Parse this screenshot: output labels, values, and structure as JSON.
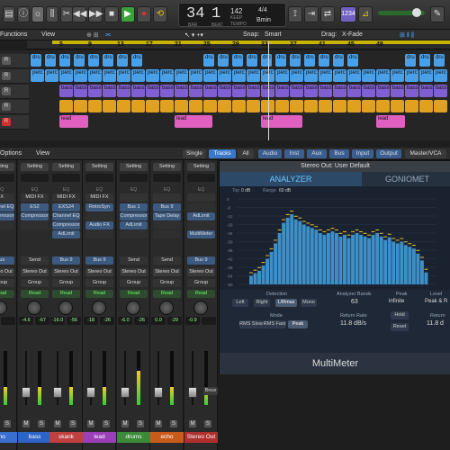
{
  "toolbar": {
    "bar": "34",
    "beat": "1",
    "bar_label": "BAR",
    "beat_label": "BEAT",
    "tempo": "142",
    "tempo_label": "KEEP",
    "tempo_sub": "TEMPO",
    "sig": "4/4",
    "key": "Bmin",
    "count_in": "1234"
  },
  "menubar": {
    "functions": "Functions",
    "view": "View",
    "snap_label": "Snap:",
    "snap_value": "Smart",
    "drag_label": "Drag:",
    "drag_value": "X-Fade"
  },
  "ruler": [
    "5",
    "9",
    "13",
    "17",
    "21",
    "25",
    "29",
    "33",
    "37",
    "41",
    "45",
    "49"
  ],
  "tracks": [
    {
      "rec": "R",
      "regions": [
        {
          "label": "dru",
          "x": 34,
          "w": 12
        },
        {
          "label": "dru",
          "x": 50,
          "w": 12
        },
        {
          "label": "dru",
          "x": 66,
          "w": 12
        },
        {
          "label": "dru",
          "x": 82,
          "w": 12
        },
        {
          "label": "dru",
          "x": 98,
          "w": 12
        },
        {
          "label": "dru",
          "x": 114,
          "w": 12
        },
        {
          "label": "dru",
          "x": 130,
          "w": 12
        },
        {
          "label": "dru",
          "x": 146,
          "w": 12
        },
        {
          "label": "dru",
          "x": 226,
          "w": 12
        },
        {
          "label": "dru",
          "x": 242,
          "w": 12
        },
        {
          "label": "dru",
          "x": 258,
          "w": 12
        },
        {
          "label": "dru",
          "x": 274,
          "w": 12
        },
        {
          "label": "dru",
          "x": 290,
          "w": 12
        },
        {
          "label": "dru",
          "x": 306,
          "w": 12
        },
        {
          "label": "dru",
          "x": 322,
          "w": 12
        },
        {
          "label": "dru",
          "x": 338,
          "w": 12
        },
        {
          "label": "dru",
          "x": 354,
          "w": 12
        },
        {
          "label": "dru",
          "x": 370,
          "w": 12
        },
        {
          "label": "dru",
          "x": 386,
          "w": 12
        },
        {
          "label": "dru",
          "x": 450,
          "w": 12
        },
        {
          "label": "dru",
          "x": 466,
          "w": 12
        },
        {
          "label": "dru",
          "x": 482,
          "w": 12
        }
      ]
    },
    {
      "rec": "R",
      "regions": [
        {
          "label": "perc",
          "x": 34,
          "w": 15
        },
        {
          "label": "perc",
          "x": 50,
          "w": 15
        },
        {
          "label": "perc",
          "x": 66,
          "w": 15
        },
        {
          "label": "perc",
          "x": 82,
          "w": 15
        },
        {
          "label": "perc",
          "x": 98,
          "w": 15
        },
        {
          "label": "perc",
          "x": 114,
          "w": 15
        },
        {
          "label": "perc",
          "x": 130,
          "w": 15
        },
        {
          "label": "perc",
          "x": 146,
          "w": 15
        },
        {
          "label": "perc",
          "x": 162,
          "w": 15
        },
        {
          "label": "perc",
          "x": 178,
          "w": 15
        },
        {
          "label": "perc",
          "x": 194,
          "w": 15
        },
        {
          "label": "perc",
          "x": 210,
          "w": 15
        },
        {
          "label": "perc",
          "x": 226,
          "w": 15
        },
        {
          "label": "perc",
          "x": 242,
          "w": 15
        },
        {
          "label": "perc",
          "x": 258,
          "w": 15
        },
        {
          "label": "perc",
          "x": 274,
          "w": 15
        },
        {
          "label": "perc",
          "x": 290,
          "w": 15
        },
        {
          "label": "perc",
          "x": 306,
          "w": 15
        },
        {
          "label": "perc",
          "x": 322,
          "w": 15
        },
        {
          "label": "perc",
          "x": 338,
          "w": 15
        },
        {
          "label": "perc",
          "x": 354,
          "w": 15
        },
        {
          "label": "perc",
          "x": 370,
          "w": 15
        },
        {
          "label": "perc",
          "x": 386,
          "w": 15
        },
        {
          "label": "perc",
          "x": 402,
          "w": 15
        },
        {
          "label": "perc",
          "x": 418,
          "w": 15
        },
        {
          "label": "perc",
          "x": 434,
          "w": 15
        },
        {
          "label": "perc",
          "x": 450,
          "w": 15
        },
        {
          "label": "perc",
          "x": 466,
          "w": 15
        },
        {
          "label": "perc",
          "x": 482,
          "w": 15
        }
      ]
    },
    {
      "rec": "R",
      "regions": [
        {
          "label": "bass",
          "x": 66,
          "w": 15
        },
        {
          "label": "bass",
          "x": 82,
          "w": 15
        },
        {
          "label": "bass",
          "x": 98,
          "w": 15
        },
        {
          "label": "bass",
          "x": 114,
          "w": 15
        },
        {
          "label": "bass",
          "x": 130,
          "w": 15
        },
        {
          "label": "bass",
          "x": 146,
          "w": 15
        },
        {
          "label": "bass",
          "x": 162,
          "w": 15
        },
        {
          "label": "bass",
          "x": 178,
          "w": 15
        },
        {
          "label": "bass",
          "x": 194,
          "w": 15
        },
        {
          "label": "bass",
          "x": 210,
          "w": 15
        },
        {
          "label": "bass",
          "x": 226,
          "w": 15
        },
        {
          "label": "bass",
          "x": 242,
          "w": 15
        },
        {
          "label": "bass",
          "x": 258,
          "w": 15
        },
        {
          "label": "bass",
          "x": 274,
          "w": 15
        },
        {
          "label": "bass",
          "x": 290,
          "w": 15
        },
        {
          "label": "bass",
          "x": 306,
          "w": 15
        },
        {
          "label": "bass",
          "x": 322,
          "w": 15
        },
        {
          "label": "bass",
          "x": 338,
          "w": 15
        },
        {
          "label": "bass",
          "x": 354,
          "w": 15
        },
        {
          "label": "bass",
          "x": 370,
          "w": 15
        },
        {
          "label": "bass",
          "x": 386,
          "w": 15
        },
        {
          "label": "bass",
          "x": 402,
          "w": 15
        },
        {
          "label": "bass",
          "x": 418,
          "w": 15
        },
        {
          "label": "bass",
          "x": 434,
          "w": 15
        },
        {
          "label": "bass",
          "x": 450,
          "w": 15
        },
        {
          "label": "bass",
          "x": 466,
          "w": 15
        },
        {
          "label": "bass",
          "x": 482,
          "w": 15
        }
      ]
    },
    {
      "rec": "R",
      "regions": [
        {
          "label": "",
          "x": 66,
          "w": 15
        },
        {
          "label": "",
          "x": 82,
          "w": 15
        },
        {
          "label": "",
          "x": 98,
          "w": 15
        },
        {
          "label": "",
          "x": 114,
          "w": 15
        },
        {
          "label": "",
          "x": 130,
          "w": 15
        },
        {
          "label": "",
          "x": 146,
          "w": 15
        },
        {
          "label": "",
          "x": 162,
          "w": 15
        },
        {
          "label": "",
          "x": 178,
          "w": 15
        },
        {
          "label": "",
          "x": 194,
          "w": 15
        },
        {
          "label": "",
          "x": 210,
          "w": 15
        },
        {
          "label": "",
          "x": 226,
          "w": 15
        },
        {
          "label": "",
          "x": 242,
          "w": 15
        },
        {
          "label": "",
          "x": 258,
          "w": 15
        },
        {
          "label": "",
          "x": 274,
          "w": 15
        },
        {
          "label": "",
          "x": 290,
          "w": 15
        },
        {
          "label": "",
          "x": 306,
          "w": 15
        },
        {
          "label": "",
          "x": 322,
          "w": 15
        },
        {
          "label": "",
          "x": 338,
          "w": 15
        },
        {
          "label": "",
          "x": 354,
          "w": 15
        },
        {
          "label": "",
          "x": 370,
          "w": 15
        },
        {
          "label": "",
          "x": 386,
          "w": 15
        },
        {
          "label": "",
          "x": 402,
          "w": 15
        },
        {
          "label": "",
          "x": 418,
          "w": 15
        },
        {
          "label": "",
          "x": 434,
          "w": 15
        },
        {
          "label": "",
          "x": 450,
          "w": 15
        },
        {
          "label": "",
          "x": 466,
          "w": 15
        },
        {
          "label": "",
          "x": 482,
          "w": 15
        }
      ]
    },
    {
      "rec": "R",
      "regions": [
        {
          "label": "lead",
          "x": 66,
          "w": 32
        },
        {
          "label": "lead",
          "x": 194,
          "w": 42
        },
        {
          "label": "lead",
          "x": 290,
          "w": 46
        },
        {
          "label": "lead",
          "x": 418,
          "w": 32
        }
      ]
    }
  ],
  "mixer_header": {
    "options": "Options",
    "view": "View",
    "single": "Single",
    "tracks": "Tracks",
    "all": "All",
    "audio": "Audio",
    "inst": "Inst",
    "aux": "Aux",
    "bus": "Bus",
    "input": "Input",
    "output": "Output",
    "master": "Master/VCA"
  },
  "strips": [
    {
      "setting": "Setting",
      "eq_label": "EQ",
      "midi": "FX",
      "ins": [
        "Channel EQ",
        "Compressor",
        ""
      ],
      "send": "Bus",
      "out": "Stereo Out",
      "group": "Group",
      "auto": "Read",
      "val_l": "-11",
      "val_r": "",
      "name": "pno",
      "color": "#3a6fd0"
    },
    {
      "setting": "Setting",
      "eq_label": "EQ",
      "midi": "MIDI FX",
      "ins": [
        "ES2",
        "Compressor",
        ""
      ],
      "send": "Send",
      "out": "Stereo Out",
      "group": "Group",
      "auto": "Read",
      "val_l": "-4.6",
      "val_r": "-67",
      "name": "bass",
      "color": "#2e64c8"
    },
    {
      "setting": "Setting",
      "eq_label": "EQ",
      "midi": "MIDI FX",
      "ins": [
        "EXS24",
        "Channel EQ",
        "Compressor",
        "AdLimit"
      ],
      "send": "Bus 9",
      "out": "Stereo Out",
      "group": "Group",
      "auto": "Read",
      "val_l": "-16.0",
      "val_r": "-56",
      "name": "skank",
      "color": "#c04040"
    },
    {
      "setting": "Setting",
      "eq_label": "EQ",
      "midi": "MIDI FX",
      "ins": [
        "RetroSyn",
        "",
        "Audio FX",
        ""
      ],
      "send": "Bus 9",
      "out": "Stereo Out",
      "group": "Group",
      "auto": "Read",
      "val_l": "-18",
      "val_r": "-26",
      "name": "lead",
      "color": "#9a3fb8"
    },
    {
      "setting": "Setting",
      "eq_label": "EQ",
      "midi": "",
      "ins": [
        "Bus 1",
        "Compressor",
        "AdLimit",
        ""
      ],
      "send": "Send",
      "out": "Stereo Out",
      "group": "Group",
      "auto": "Read",
      "val_l": "-6.0",
      "val_r": "-26",
      "name": "drums",
      "color": "#3a8a3a"
    },
    {
      "setting": "Setting",
      "eq_label": "EQ",
      "midi": "",
      "ins": [
        "Bus 9",
        "Tape Delay",
        "",
        ""
      ],
      "send": "Send",
      "out": "Stereo Out",
      "group": "Group",
      "auto": "Read",
      "val_l": "0.0",
      "val_r": "-29",
      "name": "echo",
      "color": "#c85a1a"
    },
    {
      "setting": "Setting",
      "eq_label": "EQ",
      "midi": "",
      "ins": [
        "",
        "AdLimit",
        "",
        "MultiMeter"
      ],
      "send": "Bus 9",
      "out": "Stereo Out",
      "group": "Group",
      "auto": "Read",
      "val_l": "-0.9",
      "val_r": "",
      "name": "Stereo Out",
      "color": "#b02e2e"
    }
  ],
  "bounce": "Bnce",
  "multimeter": {
    "title": "Stereo Out: User Default",
    "tab_analyzer": "ANALYZER",
    "tab_gonio": "GONIOMET",
    "top_label": "Top",
    "top_val": "0 dB",
    "range_label": "Range",
    "range_val": "60 dB",
    "y_ticks": [
      "0",
      "-6",
      "-12",
      "-18",
      "-24",
      "-30",
      "-36",
      "-42",
      "-48",
      "-54",
      "-60"
    ],
    "bars": [
      0.1,
      0.13,
      0.16,
      0.22,
      0.3,
      0.38,
      0.48,
      0.6,
      0.72,
      0.78,
      0.82,
      0.76,
      0.74,
      0.7,
      0.68,
      0.66,
      0.64,
      0.6,
      0.58,
      0.6,
      0.62,
      0.6,
      0.56,
      0.58,
      0.54,
      0.58,
      0.6,
      0.58,
      0.56,
      0.54,
      0.58,
      0.6,
      0.56,
      0.52,
      0.55,
      0.5,
      0.48,
      0.5,
      0.46,
      0.44,
      0.42,
      0.36,
      0.28,
      0.14
    ],
    "detection_label": "Detection",
    "det_left": "Left",
    "det_right": "Right",
    "det_lrmax": "L/Rmax",
    "det_mono": "Mono",
    "mode_label": "Mode",
    "mode_rms_slow": "RMS Slow",
    "mode_rms_fast": "RMS Fast",
    "mode_peak": "Peak",
    "bands_label": "Analyzer Bands",
    "bands_val": "63",
    "return_label": "Return Rate",
    "return_val": "11.8 dB/s",
    "peak_label": "Peak",
    "peak_val": "infinite",
    "hold": "Hold",
    "reset": "Reset",
    "level_label": "Level",
    "level_val": "Peak & R",
    "return2_label": "Return",
    "return2_val": "11.8 d",
    "footer": "MultiMeter"
  }
}
